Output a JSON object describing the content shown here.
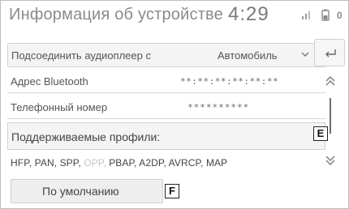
{
  "header": {
    "title": "Информация об устройстве",
    "clock": "4:29",
    "battery_label": "0"
  },
  "rows": {
    "connect": {
      "label": "Подсоединить аудиоплеер с",
      "value": "Автомобиль"
    },
    "bluetooth": {
      "label": "Адрес Bluetooth",
      "value": "**:**:**:**:**:**"
    },
    "phone": {
      "label": "Телефонный номер",
      "value": "**********"
    },
    "profiles": {
      "label": "Поддерживаемые профили:"
    },
    "profile_list": {
      "part1": "HFP, PAN, SPP,",
      "dimmed": "OPP,",
      "part2": "PBAP, A2DP, AVRCP, MAP"
    }
  },
  "default_button": {
    "label": "По умолчанию"
  },
  "callouts": {
    "e": "E",
    "f": "F"
  }
}
